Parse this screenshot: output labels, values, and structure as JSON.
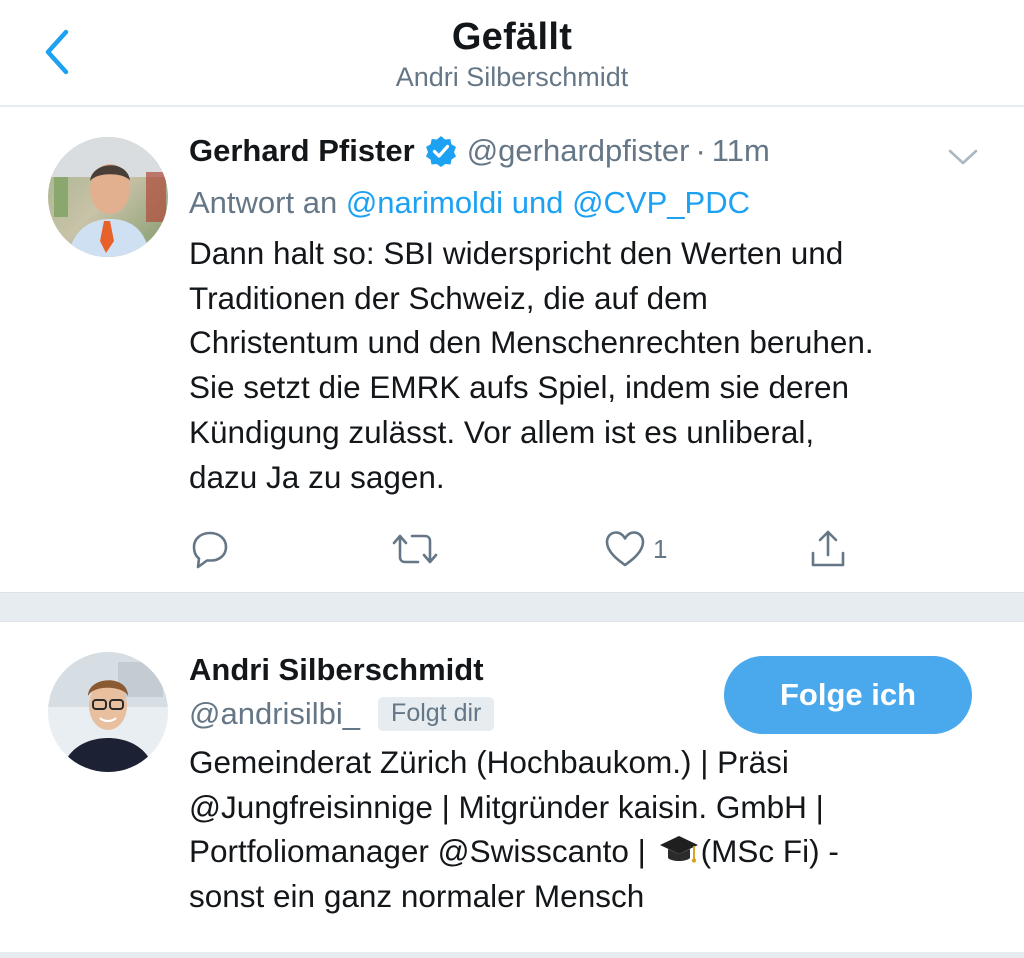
{
  "header": {
    "title": "Gefällt",
    "subtitle": "Andri Silberschmidt",
    "back_icon": "chevron-left-icon"
  },
  "tweet": {
    "author_name": "Gerhard Pfister",
    "author_handle": "@gerhardpfister",
    "separator": "·",
    "time": "11m",
    "reply_prefix": "Antwort an",
    "reply_mention_1": "@narimoldi",
    "reply_conjunction": "und",
    "reply_mention_2": "@CVP_PDC",
    "text_lines": [
      "Dann halt so: SBI widerspricht den Werten und",
      "Traditionen der Schweiz, die auf dem",
      "Christentum und den Menschenrechten beruhen.",
      "Sie setzt die EMRK aufs Spiel, indem sie deren",
      "Kündigung zulässt. Vor allem ist es unliberal,",
      "dazu Ja zu sagen."
    ],
    "like_count": "1",
    "icons": [
      "reply-icon",
      "retweet-icon",
      "like-icon",
      "share-icon",
      "verified-badge-icon",
      "chevron-down-icon"
    ]
  },
  "user": {
    "name": "Andri Silberschmidt",
    "handle": "@andrisilbi_",
    "follows_you": "Folgt dir",
    "follow_button": "Folge ich",
    "bio_lines": [
      "Gemeinderat Zürich (Hochbaukom.) | Präsi",
      "@Jungfreisinnige | Mitgründer kaisin. GmbH |",
      "Portfoliomanager @Swisscanto | ",
      "(MSc Fi) -",
      "sonst ein ganz normaler Mensch"
    ],
    "bio_emoji": "graduation-cap-icon"
  },
  "colors": {
    "accent": "#1da1f2",
    "secondary_text": "#657786",
    "divider": "#e6ecf0"
  }
}
